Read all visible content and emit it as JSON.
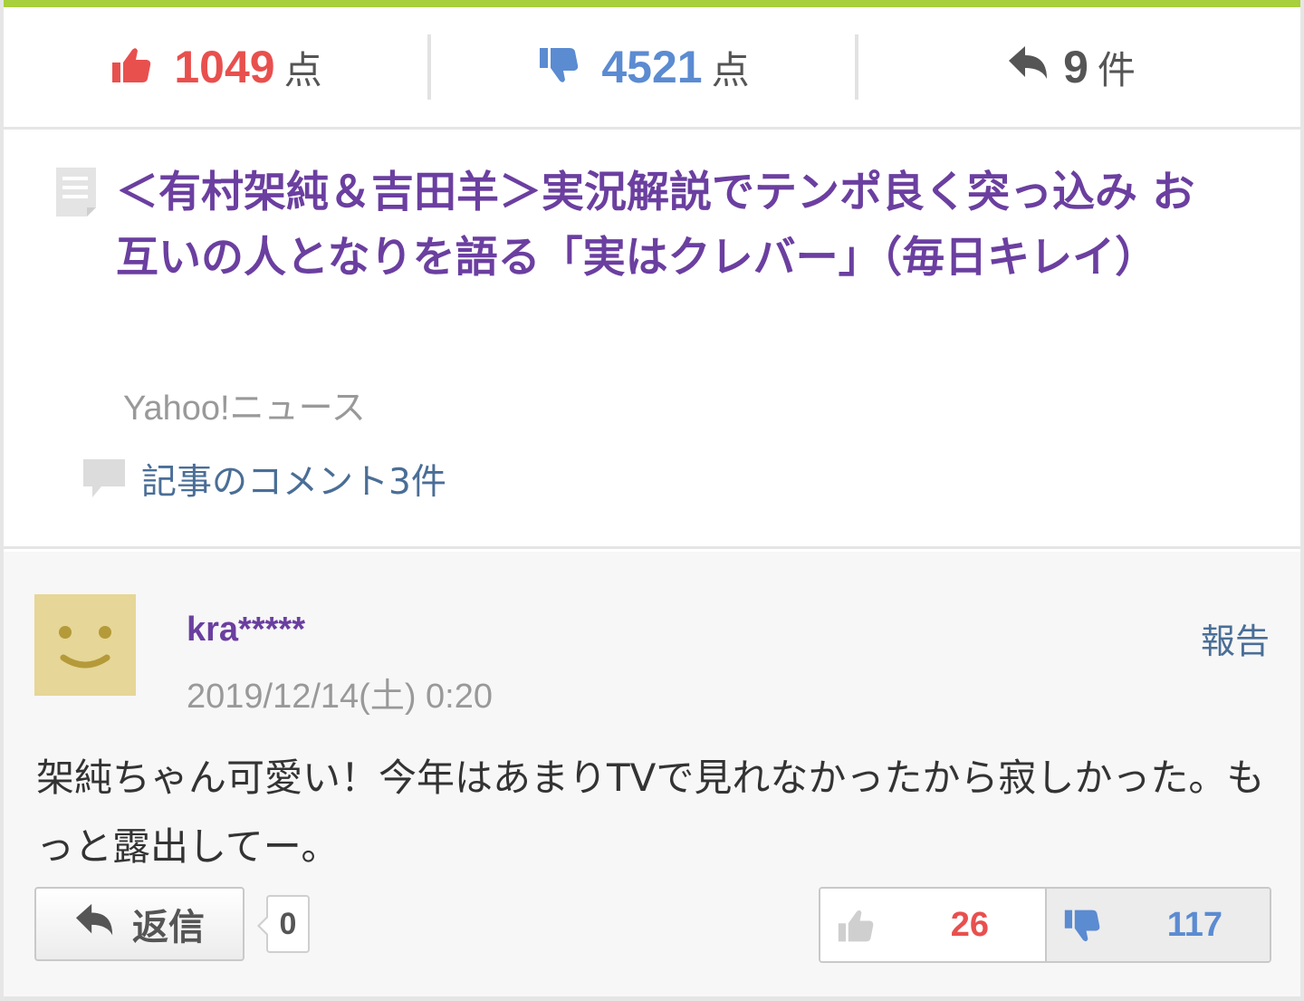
{
  "stats": {
    "up_count": "1049",
    "up_unit": "点",
    "down_count": "4521",
    "down_unit": "点",
    "reply_count": "9",
    "reply_unit": "件"
  },
  "article": {
    "title": "＜有村架純＆吉田羊＞実況解説でテンポ良く突っ込み お互いの人となりを語る「実はクレバー」（毎日キレイ）",
    "source": "Yahoo!ニュース",
    "comments_link": "記事のコメント3件"
  },
  "comment": {
    "username": "kra*****",
    "timestamp": "2019/12/14(土) 0:20",
    "report_label": "報告",
    "body": "架純ちゃん可愛い！今年はあまりTVで見れなかったから寂しかった。もっと露出してー。",
    "reply_label": "返信",
    "reply_count": "0",
    "good_count": "26",
    "bad_count": "117"
  },
  "icons": {
    "thumbs_up": "thumbs-up-icon",
    "thumbs_down": "thumbs-down-icon",
    "reply": "reply-arrow-icon",
    "document": "document-icon",
    "speech_bubble": "speech-bubble-icon",
    "avatar": "smiley-avatar"
  },
  "colors": {
    "accent": "#a8cf3c",
    "up": "#e8504e",
    "down": "#5b8bd1",
    "title": "#6b3fa0",
    "link": "#4a6e96",
    "avatar_bg": "#e6d697"
  }
}
